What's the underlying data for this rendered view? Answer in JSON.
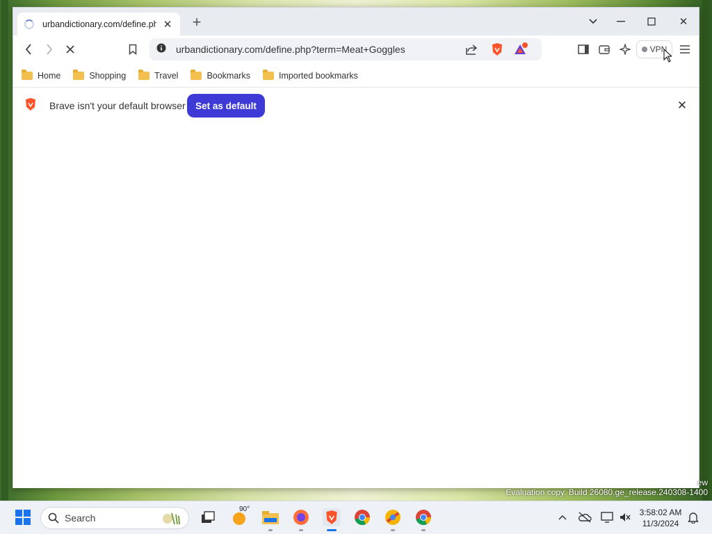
{
  "browser": {
    "tab": {
      "title": "urbandictionary.com/define.php?term=Meat+Goggles"
    },
    "omnibox": {
      "url": "urbandictionary.com/define.php?term=Meat+Goggles"
    },
    "vpn_label": "VPN",
    "notification_count": "1"
  },
  "bookmarks": [
    {
      "label": "Home"
    },
    {
      "label": "Shopping"
    },
    {
      "label": "Travel"
    },
    {
      "label": "Bookmarks"
    },
    {
      "label": "Imported bookmarks"
    }
  ],
  "infobar": {
    "message": "Brave isn't your default browser",
    "button": "Set as default"
  },
  "taskbar": {
    "search_placeholder": "Search",
    "weather_temp": "90°",
    "time": "3:58:02 AM",
    "date": "11/3/2024"
  },
  "desktop": {
    "watermark_line1": "ew",
    "watermark_line2": "Evaluation copy. Build 26080.ge_release.240308-1400"
  },
  "colors": {
    "brave_orange": "#fb542b",
    "accent_button": "#3e3ad6"
  }
}
